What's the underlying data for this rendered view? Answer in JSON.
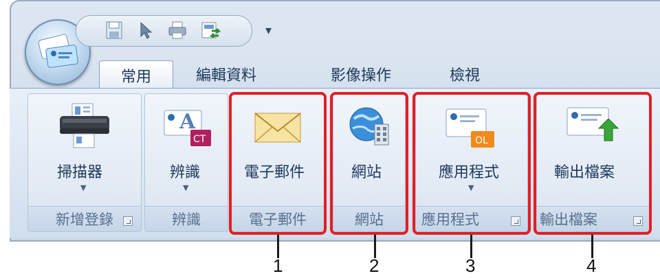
{
  "quick_access": {
    "icons": [
      "save-icon",
      "pointer-icon",
      "print-icon",
      "swap-icon"
    ],
    "dropdown_glyph": "▾"
  },
  "tabs": [
    {
      "label": "常用",
      "active": true
    },
    {
      "label": "編輯資料",
      "active": false
    },
    {
      "label": "影像操作",
      "active": false
    },
    {
      "label": "檢視",
      "active": false
    }
  ],
  "groups": [
    {
      "button": "掃描器",
      "footer": "新增登錄",
      "has_dropdown": true,
      "has_launcher": true,
      "icon": "scanner-icon"
    },
    {
      "button": "辨識",
      "footer": "辨識",
      "has_dropdown": true,
      "has_launcher": false,
      "icon": "ocr-icon",
      "badge": "CT"
    },
    {
      "button": "電子郵件",
      "footer": "電子郵件",
      "has_dropdown": false,
      "has_launcher": false,
      "icon": "envelope-icon"
    },
    {
      "button": "網站",
      "footer": "網站",
      "has_dropdown": false,
      "has_launcher": false,
      "icon": "globe-icon"
    },
    {
      "button": "應用程式",
      "footer": "應用程式",
      "has_dropdown": true,
      "has_launcher": true,
      "icon": "card-app-icon",
      "badge": "OL"
    },
    {
      "button": "輸出檔案",
      "footer": "輸出檔案",
      "has_dropdown": false,
      "has_launcher": true,
      "icon": "card-export-icon"
    }
  ],
  "callouts": [
    "1",
    "2",
    "3",
    "4"
  ],
  "colors": {
    "highlight": "#e31e24",
    "label": "#1e395b",
    "footer": "#59708e",
    "badge_ct": "#b0205f",
    "badge_ol": "#f08a1c",
    "export_arrow": "#3aa53a"
  }
}
